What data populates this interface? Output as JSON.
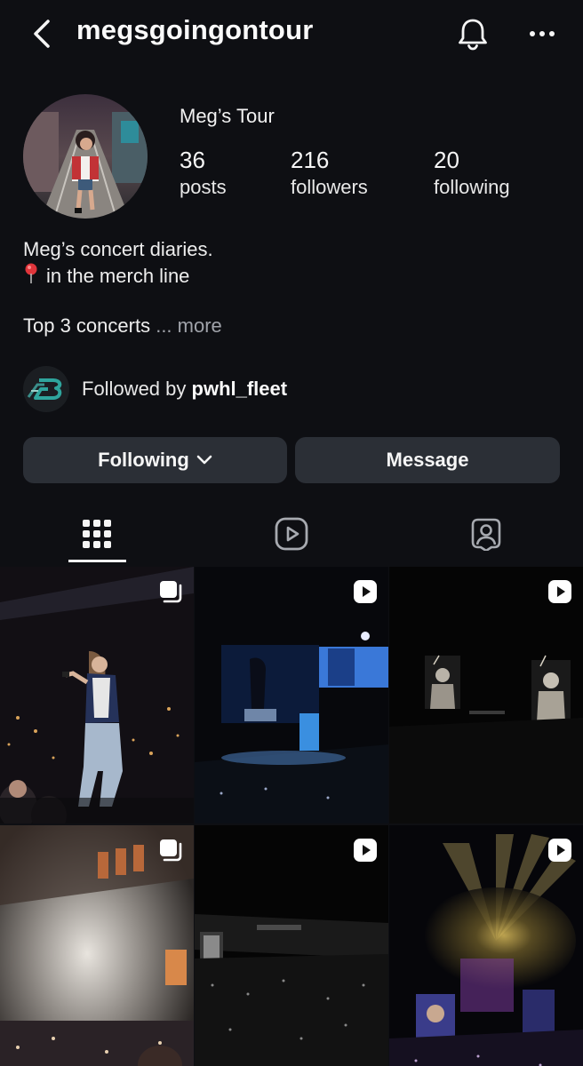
{
  "header": {
    "username": "megsgoingontour"
  },
  "profile": {
    "display_name": "Meg’s Tour",
    "stats": [
      {
        "value": "36",
        "label": "posts"
      },
      {
        "value": "216",
        "label": "followers"
      },
      {
        "value": "20",
        "label": "following"
      }
    ],
    "bio_line1": "Meg’s concert diaries.",
    "bio_line2": "in the merch line",
    "bio_more_text": "Top 3 concerts",
    "bio_more_link": "... more",
    "followed_by_prefix": "Followed by",
    "followed_by_user": "pwhl_fleet"
  },
  "actions": {
    "following_label": "Following",
    "message_label": "Message"
  },
  "tabs": [
    {
      "name": "grid",
      "icon": "grid-icon",
      "selected": true
    },
    {
      "name": "reels",
      "icon": "reels-icon",
      "selected": false
    },
    {
      "name": "tagged",
      "icon": "tagged-icon",
      "selected": false
    }
  ],
  "posts": [
    {
      "type": "carousel",
      "badge_icon": "carousel-icon"
    },
    {
      "type": "reel",
      "badge_icon": "reel-icon"
    },
    {
      "type": "reel",
      "badge_icon": "reel-icon"
    },
    {
      "type": "carousel",
      "badge_icon": "carousel-icon"
    },
    {
      "type": "reel",
      "badge_icon": "reel-icon"
    },
    {
      "type": "reel",
      "badge_icon": "reel-icon"
    }
  ],
  "colors": {
    "background": "#0e0f13",
    "button": "#2b2f36",
    "text": "#f5f5f5",
    "muted": "#a0a3aa"
  }
}
